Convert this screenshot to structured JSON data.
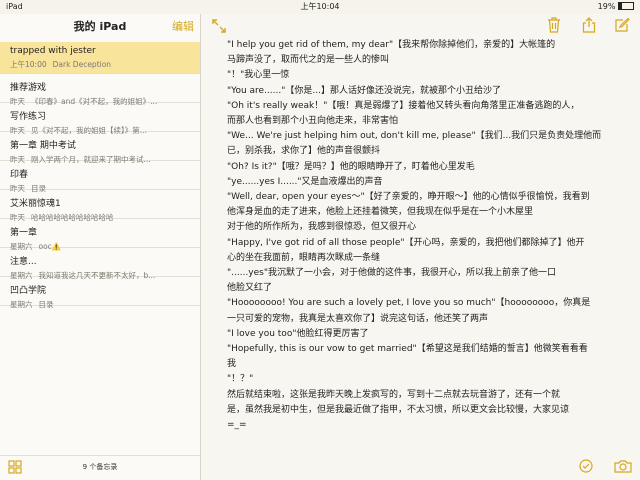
{
  "status": {
    "left": "iPad",
    "time": "上午10:04",
    "battery": "19%"
  },
  "sidebar": {
    "title": "我的 iPad",
    "edit": "编辑",
    "notes": [
      {
        "title": "trapped with jester",
        "date": "上午10:00",
        "preview": "Dark Deception"
      },
      {
        "title": "推荐游戏",
        "date": "昨天",
        "preview": "《印春》and《对不起，我的姐姐》..."
      },
      {
        "title": "写作练习",
        "date": "昨天",
        "preview": "见《对不起，我的姐姐【续】》第..."
      },
      {
        "title": "第一章 期中考试",
        "date": "昨天",
        "preview": "刚入学两个月，就迎来了期中考试..."
      },
      {
        "title": "印春",
        "date": "昨天",
        "preview": "目录"
      },
      {
        "title": "艾米丽惊魂1",
        "date": "昨天",
        "preview": "哈哈哈哈哈哈哈哈哈哈哈"
      },
      {
        "title": "第一章",
        "date": "星期六",
        "preview": "ooc⚠️"
      },
      {
        "title": "注意...",
        "date": "星期六",
        "preview": "我知道我这几天不更新不太好，b..."
      },
      {
        "title": "凹凸学院",
        "date": "星期六",
        "preview": "目录"
      }
    ],
    "count": "9 个备忘录"
  },
  "note": {
    "lines": [
      "\"I help you get rid of them, my dear\"【我来帮你除掉他们，亲爱的】大帐篷的",
      "马蹄声没了，取而代之的是一些人的惨叫",
      "\"！\"我心里一惊",
      "\"You are......\"【你是...】那人话好像还没说完，就被那个小丑给沙了",
      "\"Oh it's really weak！\"【哦！真是弱爆了】接着他又转头看向角落里正准备逃跑的人，",
      "而那人也看到那个小丑向他走来，非常害怕",
      "\"We... We're just helping him out, don't kill me, please\"【我们...我们只是负责处理他而",
      "已，别杀我，求你了】他的声音很颤抖",
      "\"Oh? Is it?\"【哦？是吗？】他的眼睛睁开了，盯着他心里发毛",
      "\"ye......yes I......\"又是血液爆出的声音",
      "\"Well, dear, open your eyes～\"【好了亲爱的，睁开眼～】他的心情似乎很愉悦，我看到",
      "他浑身是血的走了进来，他脸上还挂着微笑，但我现在似乎是在一个小木屋里",
      "对于他的所作所为，我感到很惊恐，但又很开心",
      "\"Happy, I've got rid of all those people\"【开心吗，亲爱的，我把他们都除掉了】他开",
      "心的坐在我面前，眼睛再次眯成一条缝",
      "\"......yes\"我沉默了一小会，对于他做的这件事，我很开心，所以我上前亲了他一口",
      "他脸又红了",
      "\"Hoooooooo!  You are such a lovely pet, I love you so much\"【hoooooooo，你真是",
      "一只可爱的宠物，我真是太喜欢你了】说完这句话，他还笑了两声",
      "\"I love you too\"他脸红得更厉害了",
      "\"Hopefully, this is our vow to get married\"【希望这是我们结婚的誓言】他微笑看看看",
      "我",
      "\"！？\"",
      "然后就结束啦，这张是我昨天晚上发疯写的，写到十二点就去玩音游了，还有一个就",
      "是，虽然我是初中生，但是我最近做了指甲，不太习惯，所以更文会比较慢，大家见谅",
      "=_="
    ]
  },
  "icons": {
    "accent": "#d6a720"
  }
}
